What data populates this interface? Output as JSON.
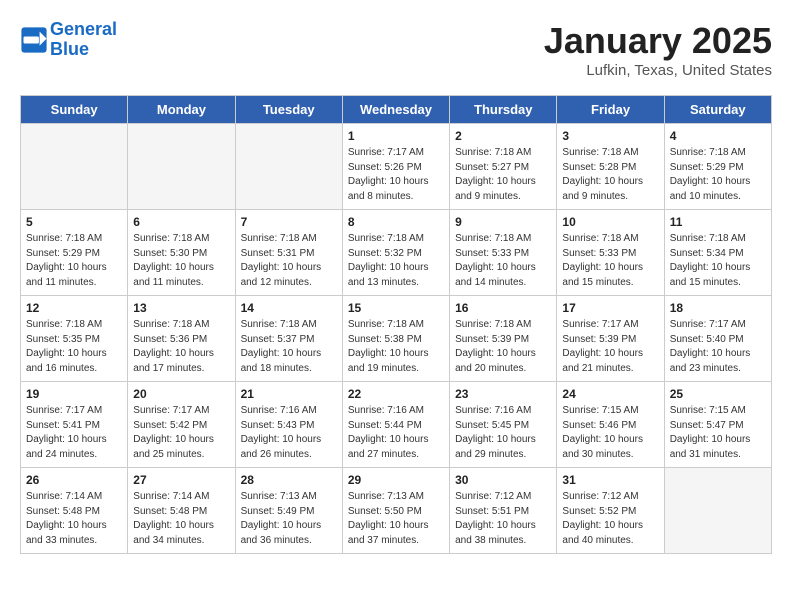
{
  "header": {
    "logo_line1": "General",
    "logo_line2": "Blue",
    "title": "January 2025",
    "subtitle": "Lufkin, Texas, United States"
  },
  "weekdays": [
    "Sunday",
    "Monday",
    "Tuesday",
    "Wednesday",
    "Thursday",
    "Friday",
    "Saturday"
  ],
  "weeks": [
    [
      {
        "day": "",
        "details": ""
      },
      {
        "day": "",
        "details": ""
      },
      {
        "day": "",
        "details": ""
      },
      {
        "day": "1",
        "details": "Sunrise: 7:17 AM\nSunset: 5:26 PM\nDaylight: 10 hours\nand 8 minutes."
      },
      {
        "day": "2",
        "details": "Sunrise: 7:18 AM\nSunset: 5:27 PM\nDaylight: 10 hours\nand 9 minutes."
      },
      {
        "day": "3",
        "details": "Sunrise: 7:18 AM\nSunset: 5:28 PM\nDaylight: 10 hours\nand 9 minutes."
      },
      {
        "day": "4",
        "details": "Sunrise: 7:18 AM\nSunset: 5:29 PM\nDaylight: 10 hours\nand 10 minutes."
      }
    ],
    [
      {
        "day": "5",
        "details": "Sunrise: 7:18 AM\nSunset: 5:29 PM\nDaylight: 10 hours\nand 11 minutes."
      },
      {
        "day": "6",
        "details": "Sunrise: 7:18 AM\nSunset: 5:30 PM\nDaylight: 10 hours\nand 11 minutes."
      },
      {
        "day": "7",
        "details": "Sunrise: 7:18 AM\nSunset: 5:31 PM\nDaylight: 10 hours\nand 12 minutes."
      },
      {
        "day": "8",
        "details": "Sunrise: 7:18 AM\nSunset: 5:32 PM\nDaylight: 10 hours\nand 13 minutes."
      },
      {
        "day": "9",
        "details": "Sunrise: 7:18 AM\nSunset: 5:33 PM\nDaylight: 10 hours\nand 14 minutes."
      },
      {
        "day": "10",
        "details": "Sunrise: 7:18 AM\nSunset: 5:33 PM\nDaylight: 10 hours\nand 15 minutes."
      },
      {
        "day": "11",
        "details": "Sunrise: 7:18 AM\nSunset: 5:34 PM\nDaylight: 10 hours\nand 15 minutes."
      }
    ],
    [
      {
        "day": "12",
        "details": "Sunrise: 7:18 AM\nSunset: 5:35 PM\nDaylight: 10 hours\nand 16 minutes."
      },
      {
        "day": "13",
        "details": "Sunrise: 7:18 AM\nSunset: 5:36 PM\nDaylight: 10 hours\nand 17 minutes."
      },
      {
        "day": "14",
        "details": "Sunrise: 7:18 AM\nSunset: 5:37 PM\nDaylight: 10 hours\nand 18 minutes."
      },
      {
        "day": "15",
        "details": "Sunrise: 7:18 AM\nSunset: 5:38 PM\nDaylight: 10 hours\nand 19 minutes."
      },
      {
        "day": "16",
        "details": "Sunrise: 7:18 AM\nSunset: 5:39 PM\nDaylight: 10 hours\nand 20 minutes."
      },
      {
        "day": "17",
        "details": "Sunrise: 7:17 AM\nSunset: 5:39 PM\nDaylight: 10 hours\nand 21 minutes."
      },
      {
        "day": "18",
        "details": "Sunrise: 7:17 AM\nSunset: 5:40 PM\nDaylight: 10 hours\nand 23 minutes."
      }
    ],
    [
      {
        "day": "19",
        "details": "Sunrise: 7:17 AM\nSunset: 5:41 PM\nDaylight: 10 hours\nand 24 minutes."
      },
      {
        "day": "20",
        "details": "Sunrise: 7:17 AM\nSunset: 5:42 PM\nDaylight: 10 hours\nand 25 minutes."
      },
      {
        "day": "21",
        "details": "Sunrise: 7:16 AM\nSunset: 5:43 PM\nDaylight: 10 hours\nand 26 minutes."
      },
      {
        "day": "22",
        "details": "Sunrise: 7:16 AM\nSunset: 5:44 PM\nDaylight: 10 hours\nand 27 minutes."
      },
      {
        "day": "23",
        "details": "Sunrise: 7:16 AM\nSunset: 5:45 PM\nDaylight: 10 hours\nand 29 minutes."
      },
      {
        "day": "24",
        "details": "Sunrise: 7:15 AM\nSunset: 5:46 PM\nDaylight: 10 hours\nand 30 minutes."
      },
      {
        "day": "25",
        "details": "Sunrise: 7:15 AM\nSunset: 5:47 PM\nDaylight: 10 hours\nand 31 minutes."
      }
    ],
    [
      {
        "day": "26",
        "details": "Sunrise: 7:14 AM\nSunset: 5:48 PM\nDaylight: 10 hours\nand 33 minutes."
      },
      {
        "day": "27",
        "details": "Sunrise: 7:14 AM\nSunset: 5:48 PM\nDaylight: 10 hours\nand 34 minutes."
      },
      {
        "day": "28",
        "details": "Sunrise: 7:13 AM\nSunset: 5:49 PM\nDaylight: 10 hours\nand 36 minutes."
      },
      {
        "day": "29",
        "details": "Sunrise: 7:13 AM\nSunset: 5:50 PM\nDaylight: 10 hours\nand 37 minutes."
      },
      {
        "day": "30",
        "details": "Sunrise: 7:12 AM\nSunset: 5:51 PM\nDaylight: 10 hours\nand 38 minutes."
      },
      {
        "day": "31",
        "details": "Sunrise: 7:12 AM\nSunset: 5:52 PM\nDaylight: 10 hours\nand 40 minutes."
      },
      {
        "day": "",
        "details": ""
      }
    ]
  ]
}
